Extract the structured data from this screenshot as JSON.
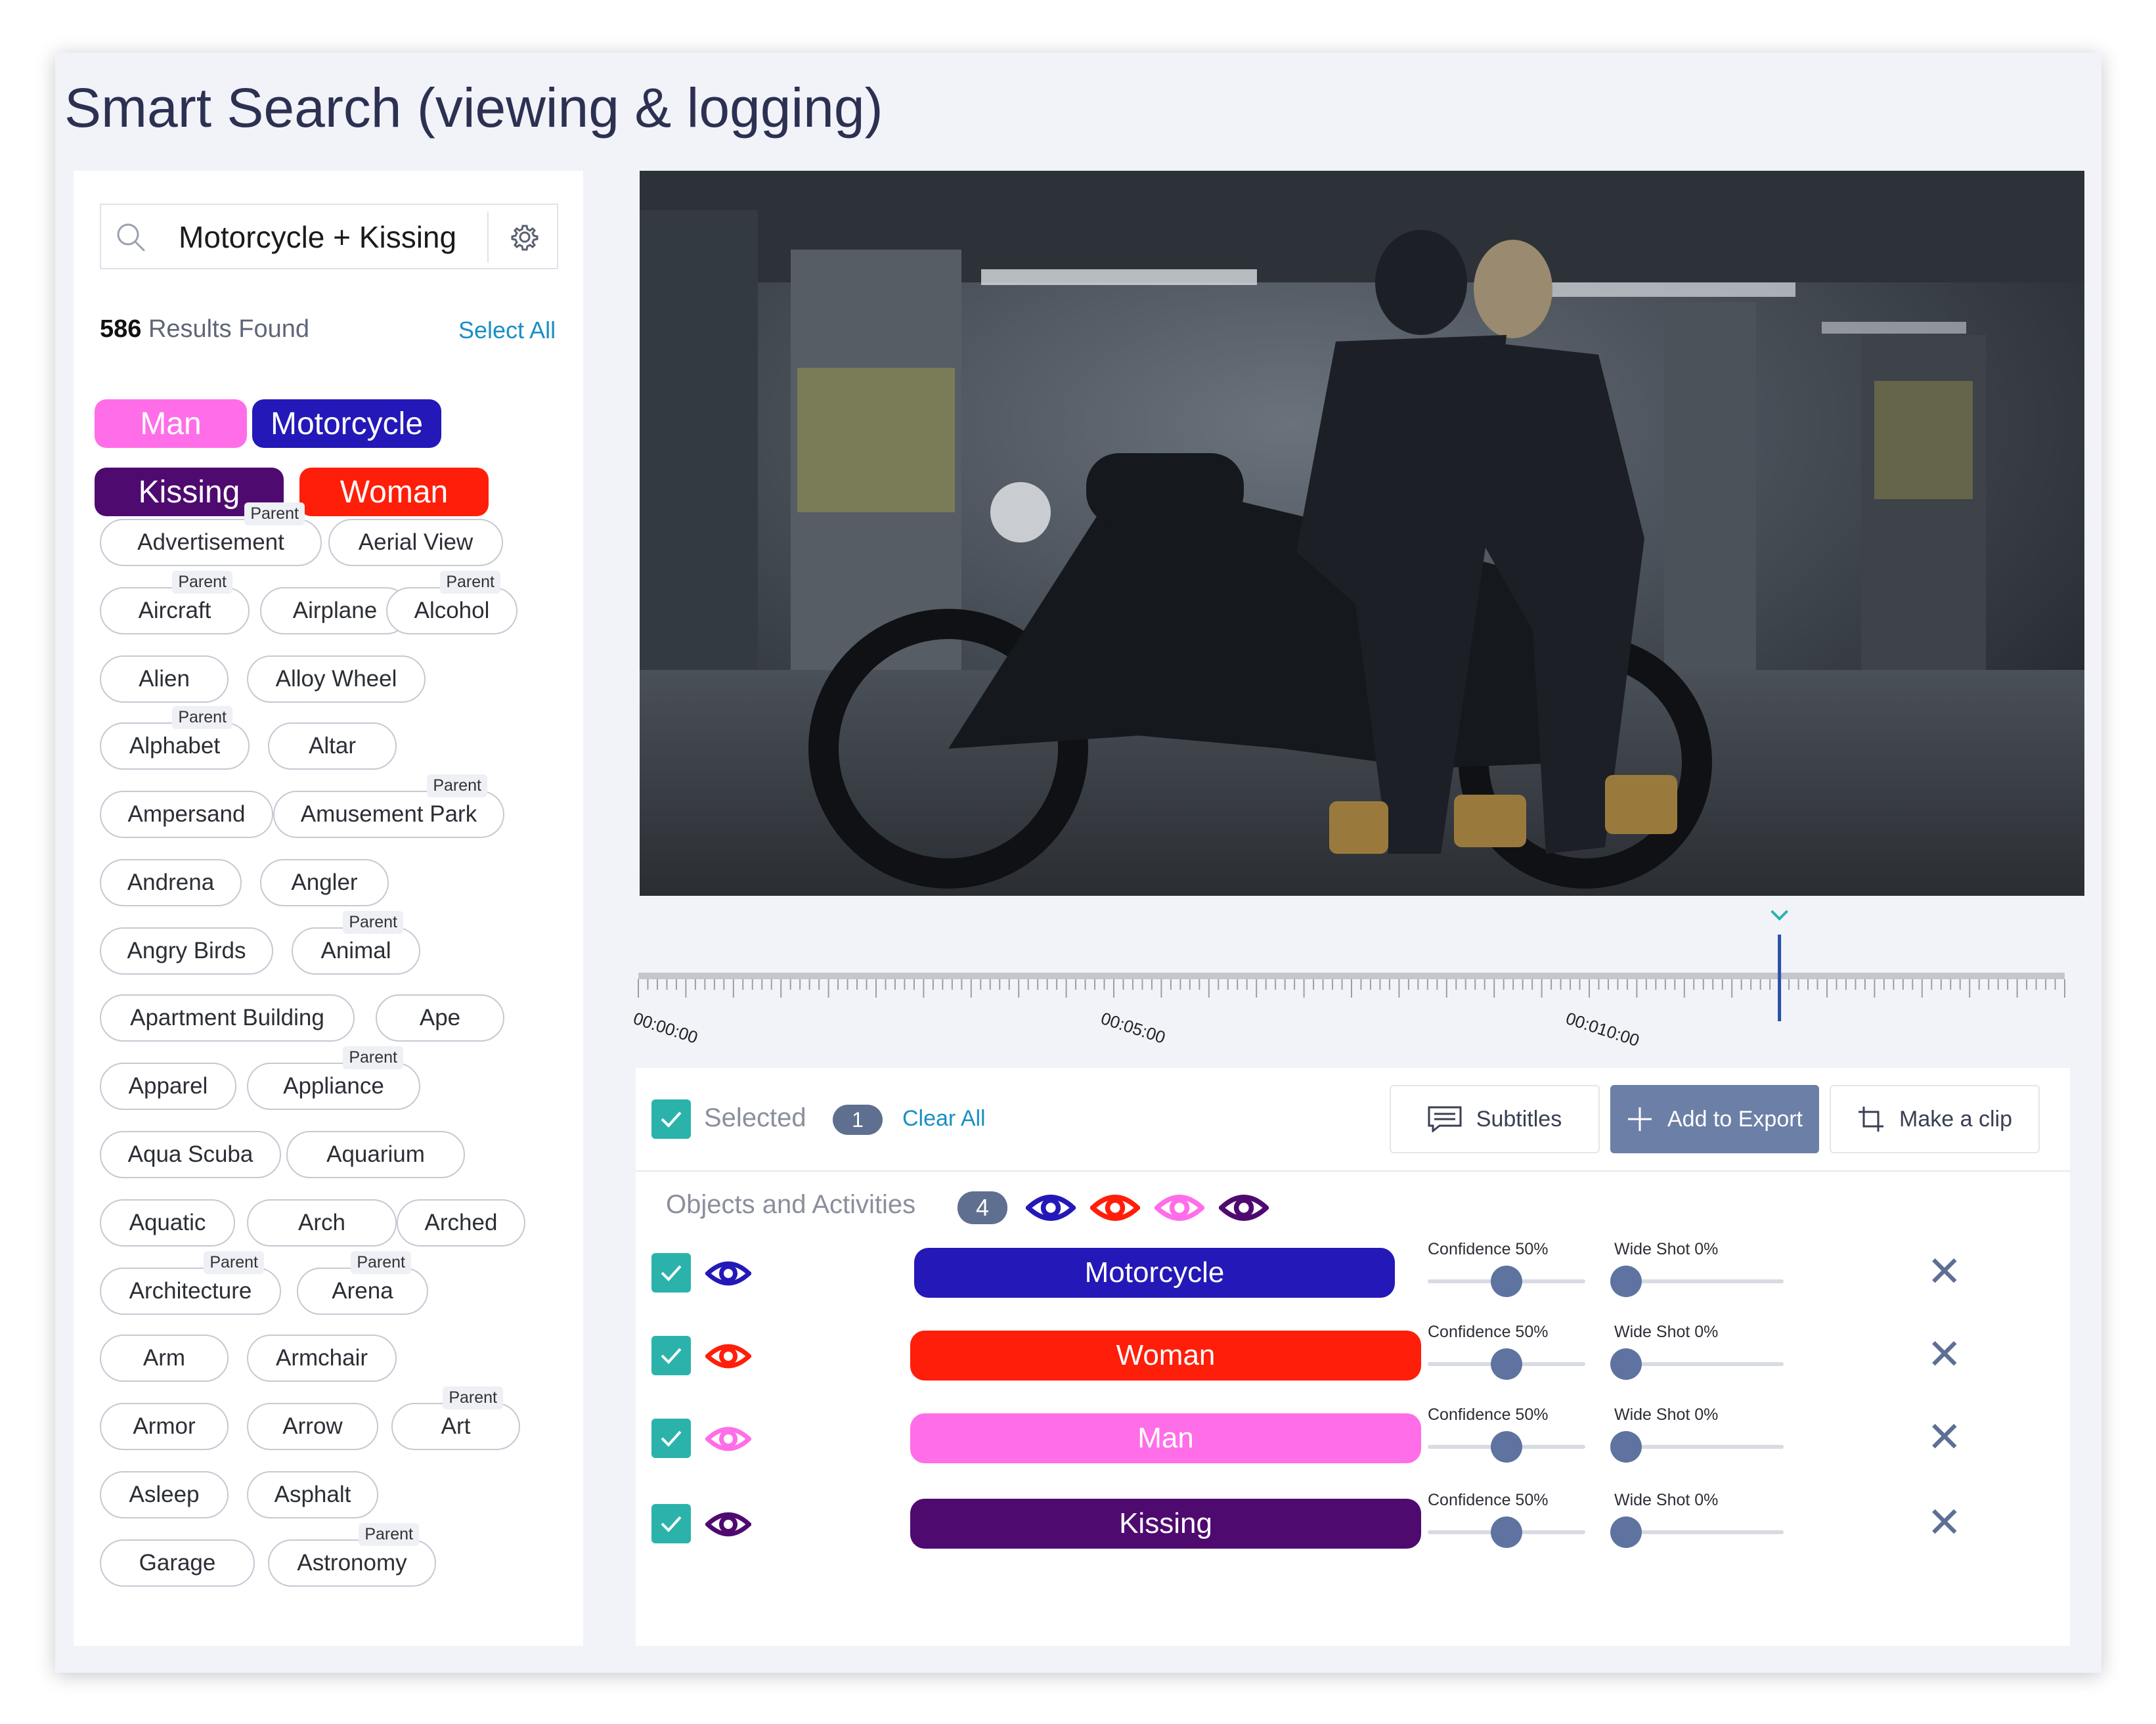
{
  "title": "Smart Search (viewing & logging)",
  "search": {
    "query": "Motorcycle + Kissing",
    "results_count": "586",
    "results_label": "Results Found",
    "select_all": "Select All"
  },
  "active_tags": [
    "Man",
    "Motorcycle",
    "Kissing",
    "Woman"
  ],
  "colors": {
    "man": "#ff6ee8",
    "motorcycle": "#2418b8",
    "kissing": "#4f0a70",
    "woman": "#ff1e0a",
    "teal": "#2bb3ab",
    "accent": "#1a8fc4"
  },
  "parent_badge": "Parent",
  "tags": [
    {
      "label": "Advertisement",
      "parent": true
    },
    {
      "label": "Aerial View",
      "parent": false
    },
    {
      "label": "Aircraft",
      "parent": true
    },
    {
      "label": "Airplane",
      "parent": false
    },
    {
      "label": "Alcohol",
      "parent": true
    },
    {
      "label": "Alien",
      "parent": false
    },
    {
      "label": "Alloy Wheel",
      "parent": false
    },
    {
      "label": "Alphabet",
      "parent": true
    },
    {
      "label": "Altar",
      "parent": false
    },
    {
      "label": "Ampersand",
      "parent": false
    },
    {
      "label": "Amusement Park",
      "parent": true
    },
    {
      "label": "Andrena",
      "parent": false
    },
    {
      "label": "Angler",
      "parent": false
    },
    {
      "label": "Angry Birds",
      "parent": false
    },
    {
      "label": "Animal",
      "parent": true
    },
    {
      "label": "Apartment Building",
      "parent": false
    },
    {
      "label": "Ape",
      "parent": false
    },
    {
      "label": "Apparel",
      "parent": false
    },
    {
      "label": "Appliance",
      "parent": true
    },
    {
      "label": "Aqua Scuba",
      "parent": false
    },
    {
      "label": "Aquarium",
      "parent": false
    },
    {
      "label": "Aquatic",
      "parent": false
    },
    {
      "label": "Arch",
      "parent": false
    },
    {
      "label": "Arched",
      "parent": false
    },
    {
      "label": "Architecture",
      "parent": true
    },
    {
      "label": "Arena",
      "parent": true
    },
    {
      "label": "Arm",
      "parent": false
    },
    {
      "label": "Armchair",
      "parent": false
    },
    {
      "label": "Armor",
      "parent": false
    },
    {
      "label": "Arrow",
      "parent": false
    },
    {
      "label": "Art",
      "parent": true
    },
    {
      "label": "Asleep",
      "parent": false
    },
    {
      "label": "Asphalt",
      "parent": false
    },
    {
      "label": "Garage",
      "parent": false
    },
    {
      "label": "Astronomy",
      "parent": true
    }
  ],
  "timeline": {
    "labels": [
      "00:00:00",
      "00:05:00",
      "00:010:00"
    ],
    "playhead_fraction": 0.8
  },
  "selection": {
    "label": "Selected",
    "count": "1",
    "clear_all": "Clear All"
  },
  "actions": {
    "subtitles": "Subtitles",
    "add_to_export": "Add to Export",
    "make_clip": "Make a clip"
  },
  "objects": {
    "label": "Objects and Activities",
    "count": "4",
    "eye_colors": [
      "#2418b8",
      "#ff1e0a",
      "#ff6ee8",
      "#4f0a70"
    ],
    "rows": [
      {
        "name": "Motorcycle",
        "color": "#2418b8",
        "confidence_label": "Confidence 50%",
        "confidence": 0.5,
        "wide_label": "Wide Shot 0%",
        "wide": 0.0
      },
      {
        "name": "Woman",
        "color": "#ff1e0a",
        "confidence_label": "Confidence 50%",
        "confidence": 0.5,
        "wide_label": "Wide Shot 0%",
        "wide": 0.0
      },
      {
        "name": "Man",
        "color": "#ff6ee8",
        "confidence_label": "Confidence 50%",
        "confidence": 0.5,
        "wide_label": "Wide Shot 0%",
        "wide": 0.0
      },
      {
        "name": "Kissing",
        "color": "#4f0a70",
        "confidence_label": "Confidence 50%",
        "confidence": 0.5,
        "wide_label": "Wide Shot 0%",
        "wide": 0.0
      }
    ]
  }
}
